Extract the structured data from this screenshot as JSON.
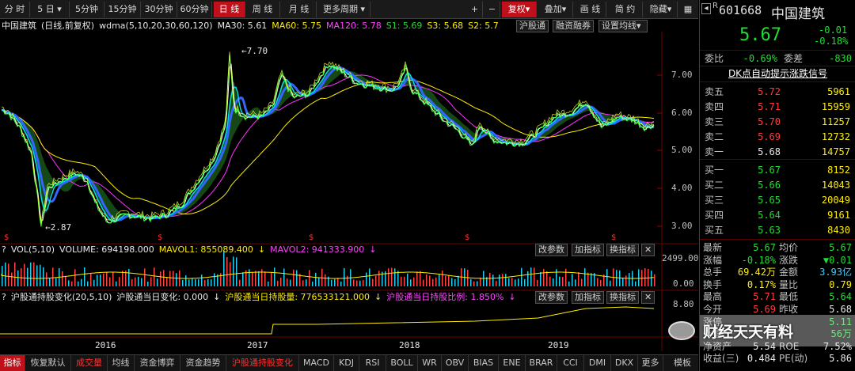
{
  "toolbar": {
    "items": [
      "分 时",
      "5 日",
      "5分钟",
      "15分钟",
      "30分钟",
      "60分钟",
      "日 线",
      "周 线",
      "月 线",
      "更多周期"
    ],
    "right_items": [
      "复权",
      "叠加",
      "画 线",
      "简 约",
      "隐藏"
    ],
    "plus": "+",
    "minus": "−"
  },
  "price_legend": {
    "name": "中国建筑",
    "mode": "(日线,前复权)",
    "indicator": "wdma(5,10,20,30,60,120)",
    "ma30": "MA30: 5.61",
    "ma60": "MA60: 5.75",
    "ma120": "MA120: 5.78",
    "s1": "S1: 5.69",
    "s3": "S3: 5.68",
    "s2": "S2: 5.7",
    "btn_hgt": "沪股通",
    "btn_margin": "融资融券",
    "btn_setup": "设置均线"
  },
  "price_axis": [
    "7.00",
    "6.00",
    "5.00",
    "4.00",
    "3.00"
  ],
  "price_annotations": {
    "high": "7.70",
    "low": "2.87"
  },
  "volume_legend": {
    "name": "VOL(5,10)",
    "volume": "VOLUME: 694198.000",
    "mavol1": "MAVOL1: 855089.400",
    "mavol2": "MAVOL2: 941333.900",
    "axis_top": "2499.00",
    "axis_bottom": "0.00"
  },
  "hgt_legend": {
    "name": "沪股通持股变化(20,5,10)",
    "v1": "沪股通当日变化: 0.000",
    "v2": "沪股通当日持股量: 776533121.000",
    "v3": "沪股通当日持股比例: 1.850%",
    "axis_top": "8.80"
  },
  "panel_buttons": [
    "改参数",
    "加指标",
    "换指标"
  ],
  "close_glyph": "✕",
  "x_axis": [
    "2016",
    "2017",
    "2018",
    "2019"
  ],
  "bottom_tabs": [
    "指标",
    "恢复默认",
    "成交量",
    "均线",
    "资金博弈",
    "资金趋势",
    "沪股通持股变化",
    "MACD",
    "KDJ",
    "RSI",
    "BOLL",
    "WR",
    "OBV",
    "BIAS",
    "ENE",
    "BRAR",
    "CCI",
    "DMI",
    "DKX",
    "更多",
    "模板"
  ],
  "quote": {
    "code": "601668",
    "name": "中国建筑",
    "price": "5.67",
    "change": "-0.01",
    "change_pct": "-0.18%",
    "weibi_label": "委比",
    "weibi": "-0.69%",
    "weicha_label": "委差",
    "weicha": "-830",
    "signal": "DK点自动提示涨跌信号",
    "asks": [
      {
        "label": "卖五",
        "price": "5.72",
        "vol": "5961"
      },
      {
        "label": "卖四",
        "price": "5.71",
        "vol": "15959"
      },
      {
        "label": "卖三",
        "price": "5.70",
        "vol": "11257"
      },
      {
        "label": "卖二",
        "price": "5.69",
        "vol": "12732"
      },
      {
        "label": "卖一",
        "price": "5.68",
        "vol": "14757"
      }
    ],
    "bids": [
      {
        "label": "买一",
        "price": "5.67",
        "vol": "8152"
      },
      {
        "label": "买二",
        "price": "5.66",
        "vol": "14043"
      },
      {
        "label": "买三",
        "price": "5.65",
        "vol": "20049"
      },
      {
        "label": "买四",
        "price": "5.64",
        "vol": "9161"
      },
      {
        "label": "买五",
        "price": "5.63",
        "vol": "8430"
      }
    ],
    "stats": [
      {
        "l1": "最新",
        "v1": "5.67",
        "l2": "均价",
        "v2": "5.67"
      },
      {
        "l1": "涨幅",
        "v1": "-0.18%",
        "l2": "涨跌",
        "v2": "▼0.01"
      },
      {
        "l1": "总手",
        "v1": "69.42万",
        "l2": "金额",
        "v2": "3.93亿"
      },
      {
        "l1": "换手",
        "v1": "0.17%",
        "l2": "量比",
        "v2": "0.79"
      },
      {
        "l1": "最高",
        "v1": "5.71",
        "l2": "最低",
        "v2": "5.64"
      },
      {
        "l1": "今开",
        "v1": "5.69",
        "l2": "昨收",
        "v2": "5.68"
      },
      {
        "l1": "涨停",
        "v1": "",
        "l2": "",
        "v2": "5.11"
      },
      {
        "l1": "外盘",
        "v1": "",
        "l2": "",
        "v2": "56万"
      },
      {
        "l1": "净资产",
        "v1": "5.54",
        "l2": "ROE",
        "v2": "7.52%"
      },
      {
        "l1": "收益(三)",
        "v1": "0.484",
        "l2": "PE(动)",
        "v2": "5.86"
      }
    ],
    "watermark": "财经天天有料"
  }
}
